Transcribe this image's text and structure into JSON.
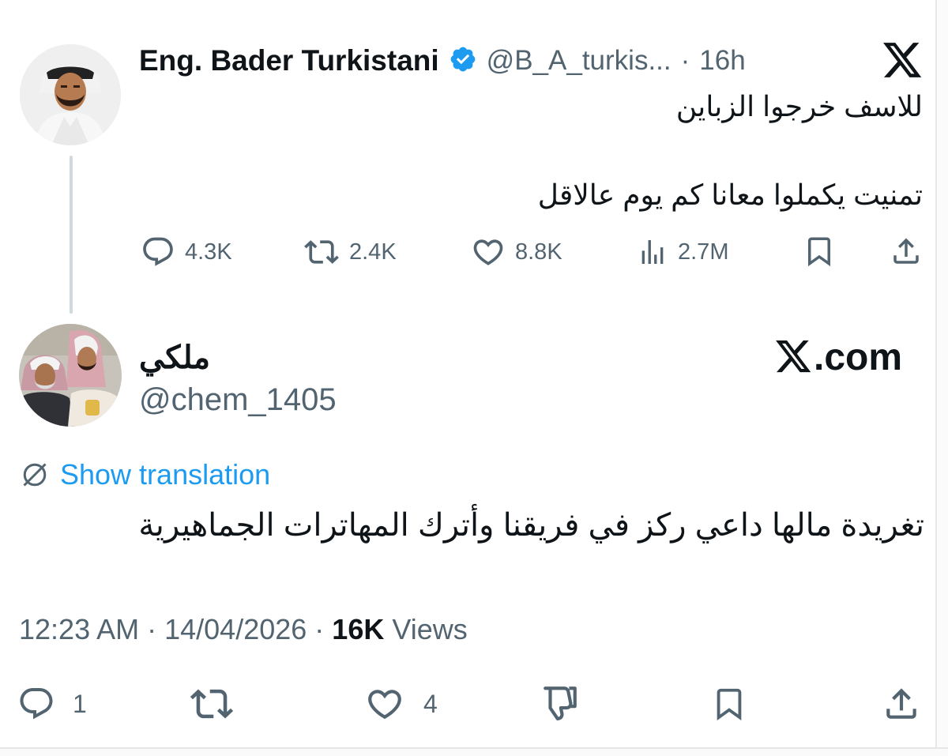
{
  "quoted": {
    "name": "Eng. Bader Turkistani",
    "handle": "@B_A_turkis...",
    "separator": "·",
    "time": "16h",
    "brand_icon": "x-logo-icon",
    "verified_color": "#1d9bf0",
    "text_line1": "للاسف خرجوا الزباين",
    "text_line2": "تمنيت يكملوا معانا كم يوم عالاقل",
    "actions": {
      "replies": "4.3K",
      "reposts": "2.4K",
      "likes": "8.8K",
      "views": "2.7M"
    }
  },
  "reply": {
    "name": "ملكي",
    "handle": "@chem_1405",
    "brand": "com",
    "show_translation": "Show translation",
    "text": "تغريدة مالها داعي ركز في فريقنا وأترك المهاترات الجماهيرية",
    "time": "12:23 AM",
    "dot1": "·",
    "date": "14/04/2026",
    "dot2": "·",
    "views_count": "16K",
    "views_label": "Views",
    "replies": "1",
    "likes": "4"
  }
}
